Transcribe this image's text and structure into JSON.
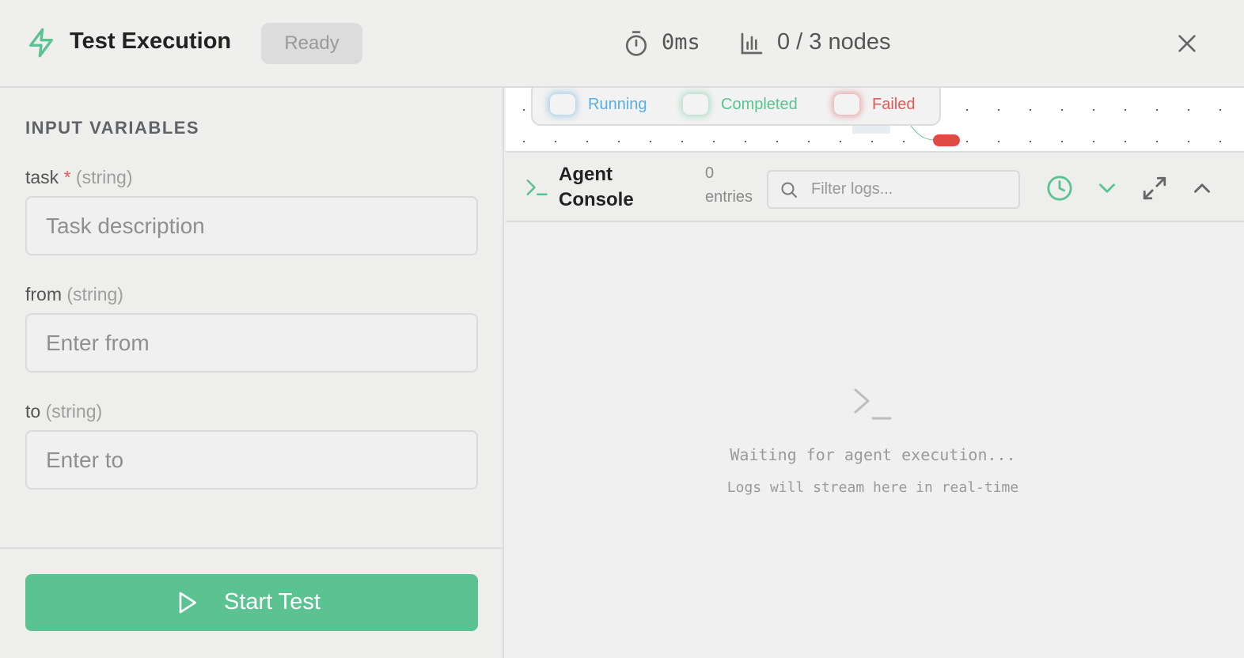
{
  "header": {
    "title": "Test Execution",
    "status": "Ready",
    "elapsed": "0ms",
    "nodes_progress": "0 / 3 nodes",
    "icons": {
      "title": "lightning-bolt-icon",
      "elapsed": "stopwatch-icon",
      "nodes": "bar-chart-icon",
      "close": "close-icon"
    }
  },
  "inputs": {
    "section_title": "INPUT VARIABLES",
    "fields": [
      {
        "name": "task",
        "required": "*",
        "type": "(string)",
        "placeholder": "Task description",
        "value": ""
      },
      {
        "name": "from",
        "type": "(string)",
        "placeholder": "Enter from",
        "value": ""
      },
      {
        "name": "to",
        "type": "(string)",
        "placeholder": "Enter to",
        "value": ""
      }
    ],
    "start_label": "Start Test"
  },
  "legend": [
    {
      "label": "Running",
      "color": "#5aaee0",
      "glow": "rgba(90,174,224,0.45)"
    },
    {
      "label": "Completed",
      "color": "#5bc392",
      "glow": "rgba(91,195,146,0.40)"
    },
    {
      "label": "Failed",
      "color": "#e05a5a",
      "glow": "rgba(224,90,90,0.45)"
    }
  ],
  "console": {
    "title": "Agent Console",
    "entries_count": "0",
    "entries_label": "entries",
    "filter_placeholder": "Filter logs...",
    "empty_title": "Waiting for agent execution...",
    "empty_subtitle": "Logs will stream here in real-time"
  },
  "colors": {
    "accent": "#5bc392",
    "danger": "#e05a5a",
    "info": "#5aaee0"
  }
}
